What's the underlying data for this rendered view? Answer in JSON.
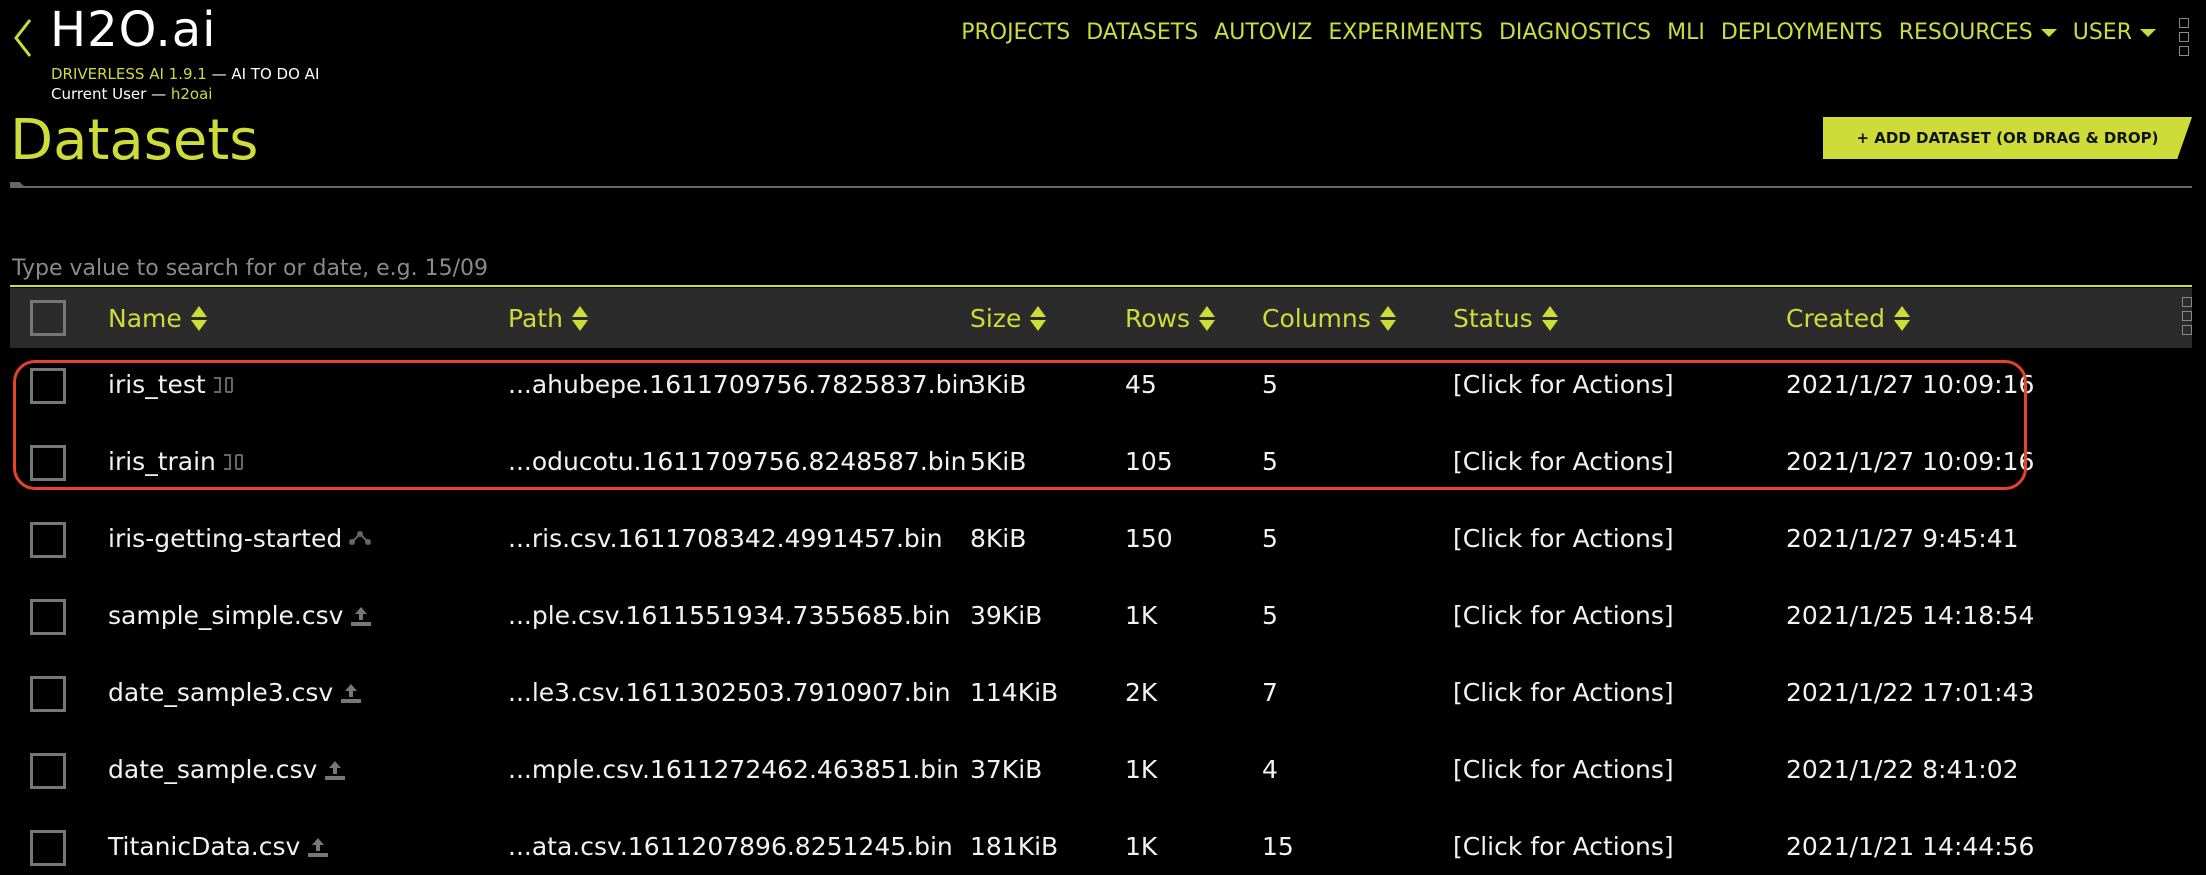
{
  "header": {
    "logo": "H2O.ai",
    "product_name": "DRIVERLESS AI 1.9.1",
    "product_tagline": " — AI TO DO AI",
    "user_prefix": "Current User — ",
    "user_name": "h2oai"
  },
  "nav": {
    "items": [
      "PROJECTS",
      "DATASETS",
      "AUTOVIZ",
      "EXPERIMENTS",
      "DIAGNOSTICS",
      "MLI",
      "DEPLOYMENTS"
    ],
    "resources": "RESOURCES",
    "user": "USER"
  },
  "page": {
    "title": "Datasets",
    "add_button": "+ ADD DATASET (OR DRAG & DROP)"
  },
  "search": {
    "placeholder": "Type value to search for or date, e.g. 15/09"
  },
  "table": {
    "columns": {
      "name": "Name",
      "path": "Path",
      "size": "Size",
      "rows": "Rows",
      "columns": "Columns",
      "status": "Status",
      "created": "Created"
    },
    "rows": [
      {
        "name": "iris_test",
        "icon": "split-icon",
        "path": "...ahubepe.1611709756.7825837.bin",
        "size": "3KiB",
        "rows": "45",
        "columns": "5",
        "status": "[Click for Actions]",
        "created": "2021/1/27 10:09:16"
      },
      {
        "name": "iris_train",
        "icon": "split-icon",
        "path": "...oducotu.1611709756.8248587.bin",
        "size": "5KiB",
        "rows": "105",
        "columns": "5",
        "status": "[Click for Actions]",
        "created": "2021/1/27 10:09:16"
      },
      {
        "name": "iris-getting-started",
        "icon": "network-icon",
        "path": "...ris.csv.1611708342.4991457.bin",
        "size": "8KiB",
        "rows": "150",
        "columns": "5",
        "status": "[Click for Actions]",
        "created": "2021/1/27 9:45:41"
      },
      {
        "name": "sample_simple.csv",
        "icon": "upload-icon",
        "path": "...ple.csv.1611551934.7355685.bin",
        "size": "39KiB",
        "rows": "1K",
        "columns": "5",
        "status": "[Click for Actions]",
        "created": "2021/1/25 14:18:54"
      },
      {
        "name": "date_sample3.csv",
        "icon": "upload-icon",
        "path": "...le3.csv.1611302503.7910907.bin",
        "size": "114KiB",
        "rows": "2K",
        "columns": "7",
        "status": "[Click for Actions]",
        "created": "2021/1/22 17:01:43"
      },
      {
        "name": "date_sample.csv",
        "icon": "upload-icon",
        "path": "...mple.csv.1611272462.463851.bin",
        "size": "37KiB",
        "rows": "1K",
        "columns": "4",
        "status": "[Click for Actions]",
        "created": "2021/1/22 8:41:02"
      },
      {
        "name": "TitanicData.csv",
        "icon": "upload-icon",
        "path": "...ata.csv.1611207896.8251245.bin",
        "size": "181KiB",
        "rows": "1K",
        "columns": "15",
        "status": "[Click for Actions]",
        "created": "2021/1/21 14:44:56"
      }
    ]
  },
  "colors": {
    "accent": "#cddc39",
    "background": "#000000",
    "highlight": "#e6432b"
  }
}
